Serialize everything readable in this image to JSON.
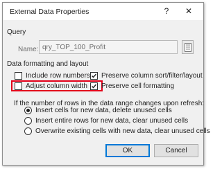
{
  "dialog": {
    "title": "External Data Properties",
    "help_glyph": "?",
    "close_glyph": "✕"
  },
  "query": {
    "section_label": "Query",
    "name_label": "Name:",
    "name_value": "qry_TOP_100_Profit"
  },
  "formatting": {
    "section_label": "Data formatting and layout",
    "options": [
      {
        "label": "Include row numbers",
        "checked": false
      },
      {
        "label": "Adjust column width",
        "checked": false,
        "highlighted": true
      },
      {
        "label": "Preserve column sort/filter/layout",
        "checked": true
      },
      {
        "label": "Preserve cell formatting",
        "checked": true
      }
    ]
  },
  "refresh": {
    "prompt": "If the number of rows in the data range changes upon refresh:",
    "options": [
      {
        "label": "Insert cells for new data, delete unused cells",
        "selected": true
      },
      {
        "label": "Insert entire rows for new data, clear unused cells",
        "selected": false
      },
      {
        "label": "Overwrite existing cells with new data, clear unused cells",
        "selected": false
      }
    ]
  },
  "buttons": {
    "ok": "OK",
    "cancel": "Cancel"
  },
  "colors": {
    "highlight": "#e2001a",
    "default_button_border": "#0078d7"
  }
}
